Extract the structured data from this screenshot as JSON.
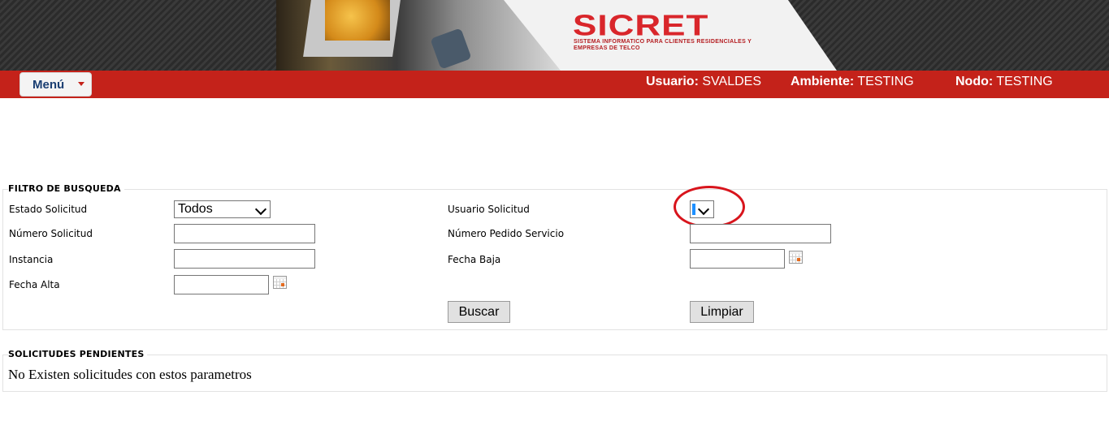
{
  "banner": {
    "logo_text": "SICRET",
    "logo_subtitle": "SISTEMA INFORMATICO PARA CLIENTES RESIDENCIALES Y EMPRESAS DE TELCO"
  },
  "navbar": {
    "menu_label": "Menú",
    "usuario_label": "Usuario:",
    "usuario_value": "SVALDES",
    "ambiente_label": "Ambiente:",
    "ambiente_value": "TESTING",
    "nodo_label": "Nodo:",
    "nodo_value": "TESTING",
    "bar_color": "#c4221a"
  },
  "filtro": {
    "legend": "FILTRO DE BUSQUEDA",
    "estado_label": "Estado Solicitud",
    "estado_value": "Todos",
    "numero_label": "Número Solicitud",
    "numero_value": "",
    "instancia_label": "Instancia",
    "instancia_value": "",
    "fecha_alta_label": "Fecha Alta",
    "fecha_alta_value": "",
    "usuario_label": "Usuario Solicitud",
    "usuario_value": "",
    "pedido_label": "Número Pedido Servicio",
    "pedido_value": "",
    "fecha_baja_label": "Fecha Baja",
    "fecha_baja_value": "",
    "buscar_label": "Buscar",
    "limpiar_label": "Limpiar"
  },
  "pendientes": {
    "legend": "SOLICITUDES PENDIENTES",
    "empty_message": "No Existen solicitudes con estos parametros"
  }
}
